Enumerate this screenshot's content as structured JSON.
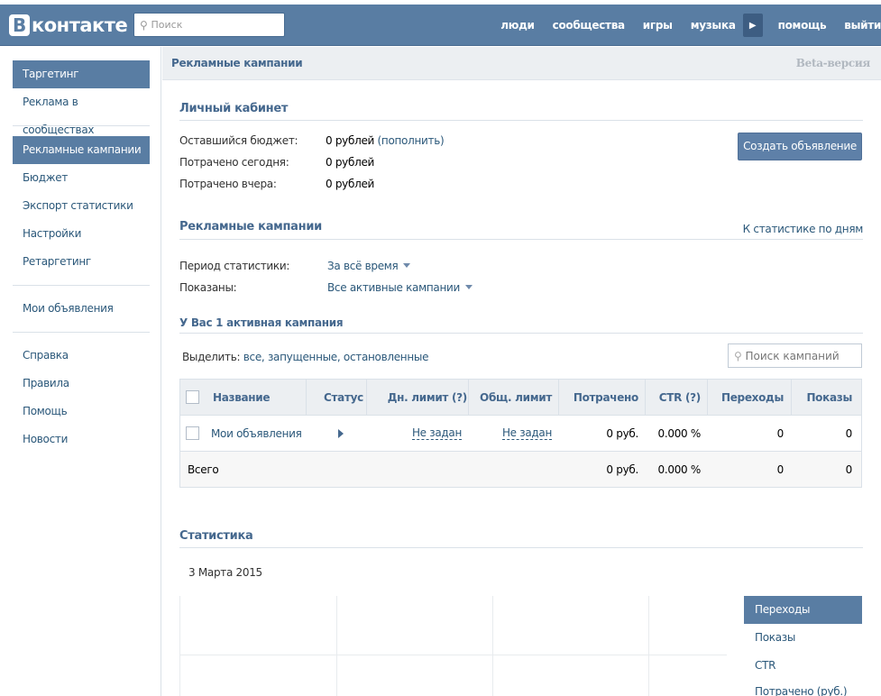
{
  "header": {
    "logo_letter": "В",
    "logo_text": "контакте",
    "search_placeholder": "Поиск",
    "nav": [
      "люди",
      "сообщества",
      "игры",
      "музыка"
    ],
    "nav_after_more": [
      "помощь",
      "выйти"
    ]
  },
  "sidebar": {
    "items": [
      {
        "label": "Таргетинг",
        "active": true
      },
      {
        "label": "Реклама в сообществах",
        "active": false
      },
      {
        "label": "Рекламные кампании",
        "active": true
      },
      {
        "label": "Бюджет",
        "active": false
      },
      {
        "label": "Экспорт статистики",
        "active": false
      },
      {
        "label": "Настройки",
        "active": false
      },
      {
        "label": "Ретаргетинг",
        "active": false
      },
      {
        "label": "Мои объявления",
        "active": false
      },
      {
        "label": "Справка",
        "active": false
      },
      {
        "label": "Правила",
        "active": false
      },
      {
        "label": "Помощь",
        "active": false
      },
      {
        "label": "Новости",
        "active": false
      }
    ]
  },
  "main": {
    "title": "Рекламные кампании",
    "beta": "Beta-версия"
  },
  "cabinet": {
    "title": "Личный кабинет",
    "rows": [
      {
        "label": "Оставшийся бюджет:",
        "value": "0 рублей",
        "link": "(пополнить)"
      },
      {
        "label": "Потрачено сегодня:",
        "value": "0 рублей"
      },
      {
        "label": "Потрачено вчера:",
        "value": "0 рублей"
      }
    ],
    "create_button": "Создать объявление"
  },
  "campaigns": {
    "title": "Рекламные кампании",
    "stats_link": "К статистике по дням",
    "period_label": "Период статистики:",
    "period_value": "За всё время",
    "shown_label": "Показаны:",
    "shown_value": "Все активные кампании",
    "active_count": "У Вас 1 активная кампания",
    "select_label": "Выделить:",
    "select_options": "все, запущенные, остановленные",
    "search_placeholder": "Поиск кампаний",
    "columns": [
      "Название",
      "Статус",
      "Дн. лимит (?)",
      "Общ. лимит",
      "Потрачено",
      "CTR (?)",
      "Переходы",
      "Показы"
    ],
    "row": {
      "name": "Мои объявления",
      "daily_limit": "Не задан",
      "total_limit": "Не задан",
      "spent": "0 руб.",
      "ctr": "0.000 %",
      "clicks": "0",
      "views": "0"
    },
    "total": {
      "label": "Всего",
      "spent": "0 руб.",
      "ctr": "0.000 %",
      "clicks": "0",
      "views": "0"
    }
  },
  "statistics": {
    "title": "Статистика",
    "date": "3 Марта 2015",
    "tabs": [
      "Переходы",
      "Показы",
      "CTR",
      "Потрачено (руб.)"
    ]
  }
}
